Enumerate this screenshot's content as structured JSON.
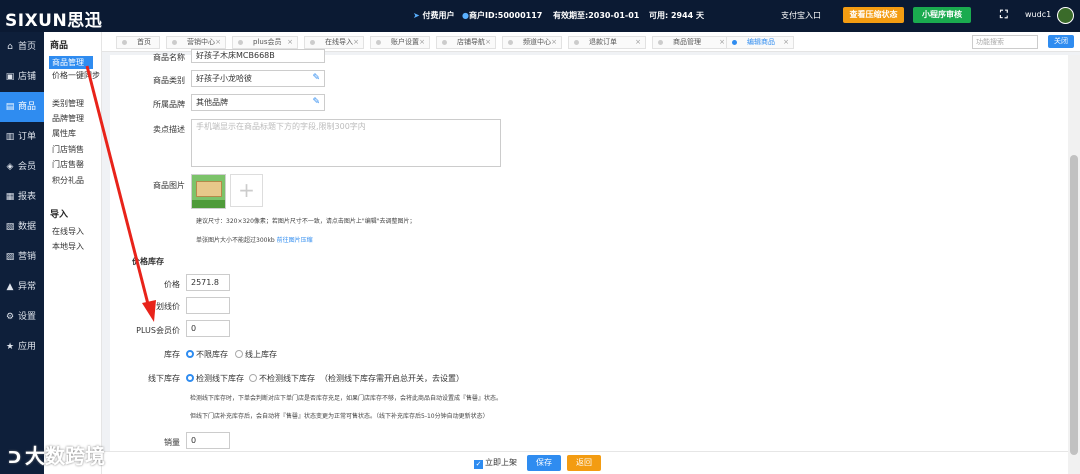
{
  "topbar": {
    "logo": "SIXUN思迅",
    "user_type": "付费用户",
    "merchant_id": "商户ID:50000117",
    "expiry": "有效期至:2030-01-01",
    "available": "可用: 2944 天",
    "alipay_entry": "支付宝入口",
    "view_status_btn": "查看压缩状态",
    "miniapp_btn": "小程序审核",
    "fullscreen_icon": "⛶",
    "username": "wudc1",
    "colors": {
      "bar": "#0b1a33",
      "orange": "#f39c12",
      "green": "#1aab4f",
      "accent": "#2f8cf0"
    }
  },
  "sidebar": {
    "items": [
      {
        "icon": "⌂",
        "label": "首页"
      },
      {
        "icon": "▣",
        "label": "店铺"
      },
      {
        "icon": "▤",
        "label": "商品"
      },
      {
        "icon": "▥",
        "label": "订单"
      },
      {
        "icon": "◈",
        "label": "会员"
      },
      {
        "icon": "▦",
        "label": "报表"
      },
      {
        "icon": "▧",
        "label": "数据"
      },
      {
        "icon": "▨",
        "label": "营销"
      },
      {
        "icon": "▲",
        "label": "异常"
      },
      {
        "icon": "⚙",
        "label": "设置"
      },
      {
        "icon": "★",
        "label": "应用"
      }
    ]
  },
  "subside": {
    "group1": "商品",
    "items1": [
      "商品管理",
      "价格一键同步",
      "类别管理",
      "品牌管理",
      "属性库",
      "门店销售",
      "门店售罄",
      "积分礼品"
    ],
    "group2": "导入",
    "items2": [
      "在线导入",
      "本地导入"
    ]
  },
  "tabs": [
    "首页",
    "营销中心",
    "plus会员",
    "在线导入",
    "账户设置",
    "店铺导航",
    "频道中心",
    "退款订单",
    "商品管理",
    "编辑商品"
  ],
  "tab_search_placeholder": "功能搜索",
  "close_all": "关闭",
  "form": {
    "name_label": "商品名称",
    "name_value": "好孩子木床MCB668B",
    "category_label": "商品类别",
    "category_value": "好孩子小龙哈彼",
    "brand_label": "所属品牌",
    "brand_value": "其他品牌",
    "selling_label": "卖点描述",
    "selling_placeholder": "手机端显示在商品标题下方的字段,限制300字内",
    "image_label": "商品图片",
    "image_note1": "建议尺寸：320×320像素；若图片尺寸不一致，请点击图片上\"编辑\"去调整图片；",
    "image_note2": "单张图片大小不能超过300kb",
    "image_note2_link": "前往图片压缩",
    "stock_section": "价格库存",
    "price_label": "价格",
    "price_value": "2571.8",
    "original_label": "划线价",
    "original_value": "",
    "plus_label": "PLUS会员价",
    "plus_value": "0",
    "stock_label": "库存",
    "stock_opt1": "不限库存",
    "stock_opt2": "线上库存",
    "offline_label": "线下库存",
    "offline_opt1": "检测线下库存",
    "offline_opt2": "不检测线下库存",
    "offline_hint": "（检测线下库存需开启总开关，去设置）",
    "offline_note1": "检测线下库存时，下单会判断对应下单门店是否库存充足，如果门店库存不够，会将此商品自动设置成『售罄』状态。",
    "offline_note2": "但线下门店补充库存后，会自动将『售罄』状态变更为正常可售状态。（线下补充库存后5-10分钟自动更新状态）",
    "sales_label": "销量",
    "sales_value": "0"
  },
  "footer": {
    "publish_label": "立即上架",
    "save_label": "保存",
    "back_label": "返回"
  },
  "watermark": "大数跨境"
}
